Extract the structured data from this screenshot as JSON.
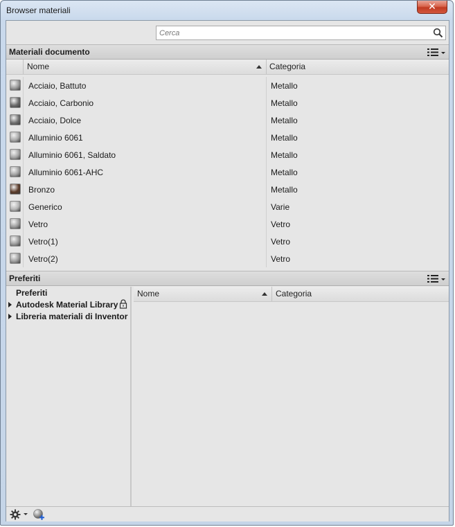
{
  "window": {
    "title": "Browser materiali",
    "close_glyph": "✕"
  },
  "search": {
    "placeholder": "Cerca",
    "value": "",
    "icon": "search-icon"
  },
  "document_materials": {
    "title": "Materiali documento",
    "columns": {
      "name": "Nome",
      "category": "Categoria",
      "sort": "ascending"
    },
    "rows": [
      {
        "name": "Acciaio, Battuto",
        "category": "Metallo",
        "swatch": "#9a9a9a"
      },
      {
        "name": "Acciaio, Carbonio",
        "category": "Metallo",
        "swatch": "#6a6a6a"
      },
      {
        "name": "Acciaio, Dolce",
        "category": "Metallo",
        "swatch": "#707070"
      },
      {
        "name": "Alluminio 6061",
        "category": "Metallo",
        "swatch": "#a8a8a8"
      },
      {
        "name": "Alluminio 6061, Saldato",
        "category": "Metallo",
        "swatch": "#a4a4a4"
      },
      {
        "name": "Alluminio 6061-AHC",
        "category": "Metallo",
        "swatch": "#a0a0a0"
      },
      {
        "name": "Bronzo",
        "category": "Metallo",
        "swatch": "#5a3a28"
      },
      {
        "name": "Generico",
        "category": "Varie",
        "swatch": "#b4b4b4"
      },
      {
        "name": "Vetro",
        "category": "Vetro",
        "swatch": "#9c9c9c"
      },
      {
        "name": "Vetro(1)",
        "category": "Vetro",
        "swatch": "#9c9c9c"
      },
      {
        "name": "Vetro(2)",
        "category": "Vetro",
        "swatch": "#9c9c9c"
      }
    ]
  },
  "favorites": {
    "title": "Preferiti",
    "tree": [
      {
        "label": "Preferiti",
        "expandable": false,
        "locked": false
      },
      {
        "label": "Autodesk Material Library",
        "expandable": true,
        "locked": true
      },
      {
        "label": "Libreria materiali di Inventor",
        "expandable": true,
        "locked": false
      }
    ],
    "columns": {
      "name": "Nome",
      "category": "Categoria",
      "sort": "ascending"
    }
  },
  "colors": {
    "panel_bg": "#e6e6e6",
    "header_bg": "#d6d6d6",
    "window_frame": "#c9d9ec",
    "close_button": "#c94a33"
  }
}
